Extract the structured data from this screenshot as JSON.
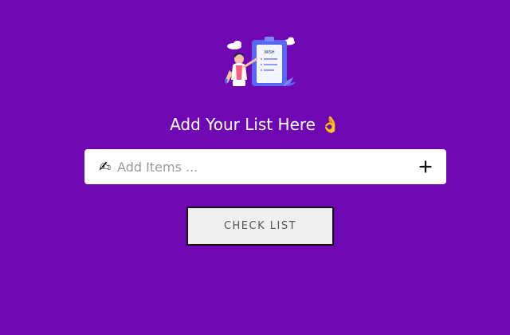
{
  "heading": {
    "title": "Add Your List Here",
    "emoji": "👌"
  },
  "illustration": {
    "icon": "todo-list-illustration-icon",
    "board_text": "WISH"
  },
  "input": {
    "icon": "✍",
    "placeholder": "Add Items ...",
    "value": ""
  },
  "add_button": {
    "icon": "plus-icon"
  },
  "check_button": {
    "label": "CHECK LIST"
  },
  "colors": {
    "background": "#6f08b2",
    "input_bg": "#ffffff",
    "button_bg": "#efefef",
    "button_border": "#111111"
  }
}
